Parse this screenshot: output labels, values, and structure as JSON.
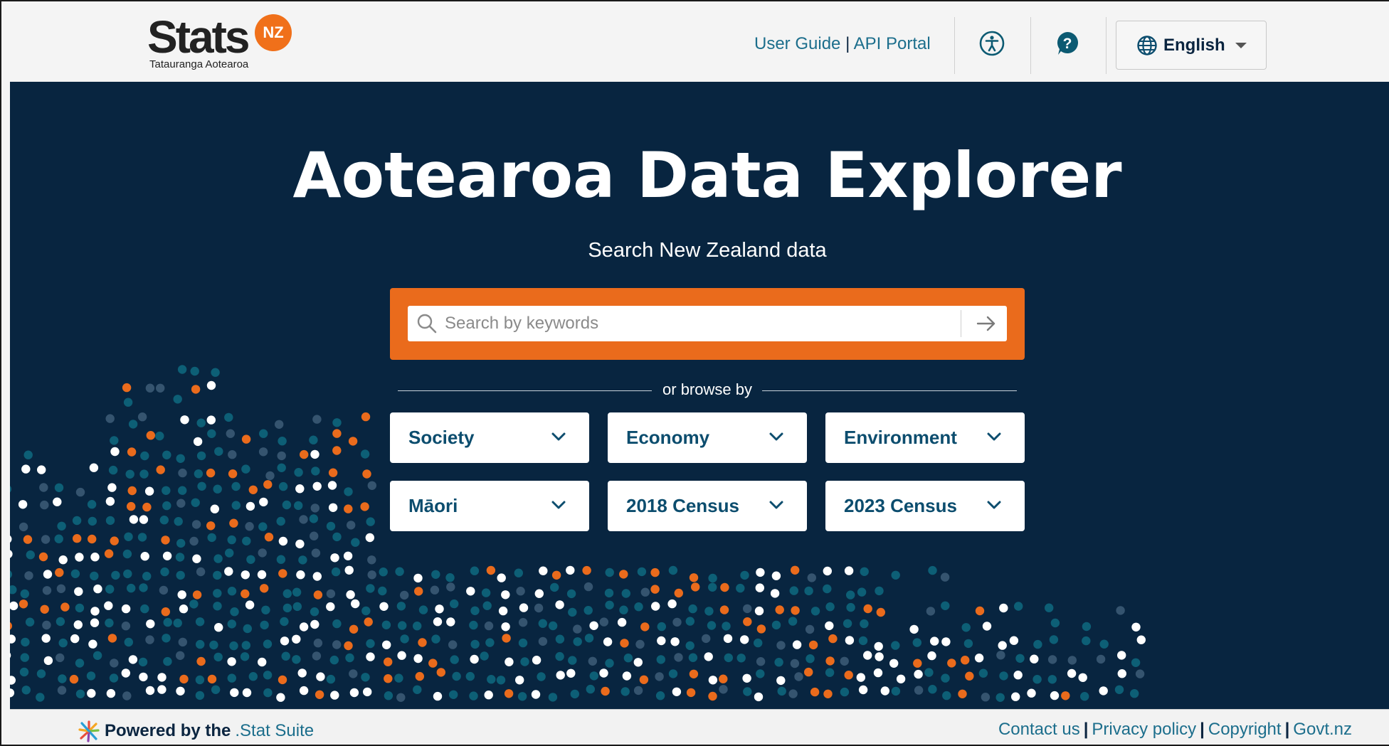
{
  "header": {
    "logo": {
      "word": "Stats",
      "badge": "NZ",
      "tagline": "Tatauranga Aotearoa"
    },
    "links": [
      "User Guide",
      "API Portal"
    ],
    "link_separator": "|",
    "icons": {
      "accessibility": "accessibility-icon",
      "help": "help-icon",
      "globe": "globe-icon"
    },
    "language": {
      "selected": "English"
    }
  },
  "hero": {
    "title": "Aotearoa Data Explorer",
    "subtitle": "Search New Zealand data",
    "search": {
      "placeholder": "Search by keywords",
      "value": ""
    },
    "browse_label": "or browse by",
    "categories": [
      "Society",
      "Economy",
      "Environment",
      "Māori",
      "2018 Census",
      "2023 Census"
    ]
  },
  "footer": {
    "powered_prefix": "Powered by the",
    "powered_link": ".Stat Suite",
    "links": [
      "Contact us",
      "Privacy policy",
      "Copyright",
      "Govt.nz"
    ]
  },
  "colors": {
    "hero_bg": "#082540",
    "accent_orange": "#ea6b1c",
    "link_teal": "#1c6e8c",
    "dot_teal": "#0e6a80",
    "dot_white": "#ffffff",
    "dot_orange": "#ea6b1c"
  }
}
